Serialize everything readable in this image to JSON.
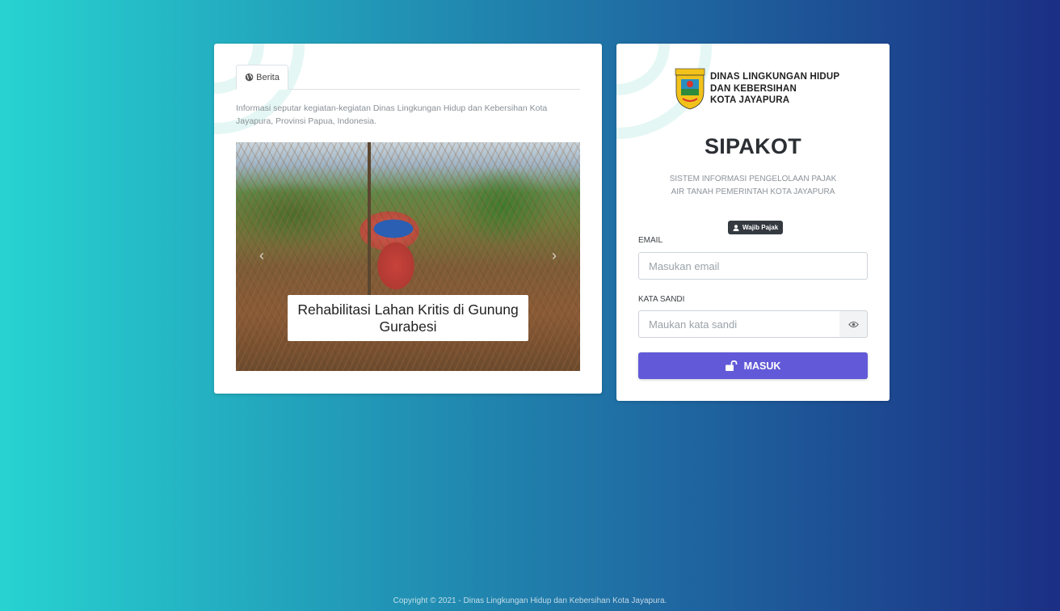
{
  "news": {
    "tab_label": "Berita",
    "tab_icon": "globe-icon",
    "description": "Informasi seputar kegiatan-kegiatan Dinas Lingkungan Hidup dan Kebersihan Kota Jayapura, Provinsi Papua, Indonesia.",
    "slide": {
      "caption": "Rehabilitasi Lahan Kritis di Gunung Gurabesi",
      "prev_icon": "chevron-left-icon",
      "next_icon": "chevron-right-icon"
    }
  },
  "login": {
    "agency_lines": [
      "DINAS LINGKUNGAN HIDUP",
      "DAN KEBERSIHAN",
      "KOTA JAYAPURA"
    ],
    "crest_text": "KOTA JAYAPURA",
    "app_name": "SIPAKOT",
    "app_subtitle_lines": [
      "SISTEM INFORMASI PENGELOLAAN PAJAK",
      "AIR TANAH PEMERINTAH KOTA JAYAPURA"
    ],
    "role_badge": "Wajib Pajak",
    "email": {
      "label": "EMAIL",
      "placeholder": "Masukan email",
      "value": ""
    },
    "password": {
      "label": "KATA SANDI",
      "placeholder": "Maukan kata sandi",
      "value": ""
    },
    "submit_label": "MASUK",
    "submit_color": "#6259d8"
  },
  "footer": {
    "text": "Copyright © 2021 - Dinas Lingkungan Hidup dan Kebersihan Kota Jayapura."
  }
}
